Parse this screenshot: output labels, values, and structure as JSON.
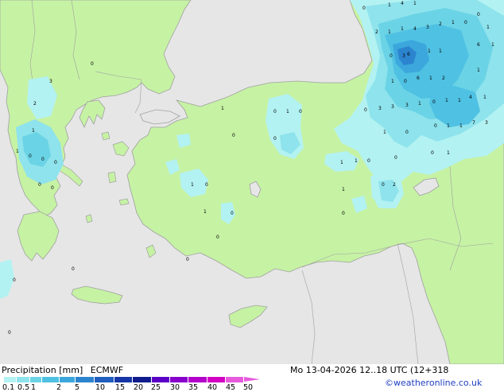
{
  "title": "Precipitation [mm]",
  "model": "ECMWF",
  "datetime": "Mo 13-04-2026 12..18 UTC (12+318",
  "credit": "©weatheronline.co.uk",
  "colors": {
    "sea": "#e6e6e6",
    "land": "#c6f2a4",
    "coast": "#a0a0a0"
  },
  "legend": {
    "ticks": [
      "0.1",
      "0.5",
      "1",
      "2",
      "5",
      "10",
      "15",
      "20",
      "25",
      "30",
      "35",
      "40",
      "45",
      "50"
    ],
    "colors": [
      "#b3f2f2",
      "#8ee3ec",
      "#6bd3e6",
      "#4fc1e3",
      "#3ca7dc",
      "#2c84cf",
      "#1f5dbf",
      "#1636a7",
      "#101c8e",
      "#5b00c6",
      "#8800cc",
      "#b300cc",
      "#d400c3",
      "#e85adc"
    ]
  },
  "precip_values": [
    "0",
    "1",
    "4",
    "1",
    "0",
    "1",
    "1",
    "4",
    "3",
    "2",
    "1",
    "0",
    "2",
    "6",
    "1",
    "1",
    "0",
    "3",
    "6",
    "1",
    "1",
    "1",
    "1",
    "0",
    "6",
    "1",
    "2",
    "0",
    "3",
    "3",
    "3",
    "1",
    "0",
    "1",
    "1",
    "4",
    "1",
    "0",
    "1",
    "1",
    "7",
    "3",
    "0",
    "1",
    "0",
    "0",
    "1",
    "0",
    "2",
    "1",
    "1",
    "0",
    "1",
    "0",
    "0",
    "1",
    "0",
    "0",
    "0",
    "1",
    "1",
    "0",
    "1",
    "0",
    "0",
    "0",
    "0",
    "3",
    "2",
    "1",
    "1",
    "0",
    "0",
    "0",
    "0",
    "0",
    "0",
    "0",
    "0"
  ]
}
